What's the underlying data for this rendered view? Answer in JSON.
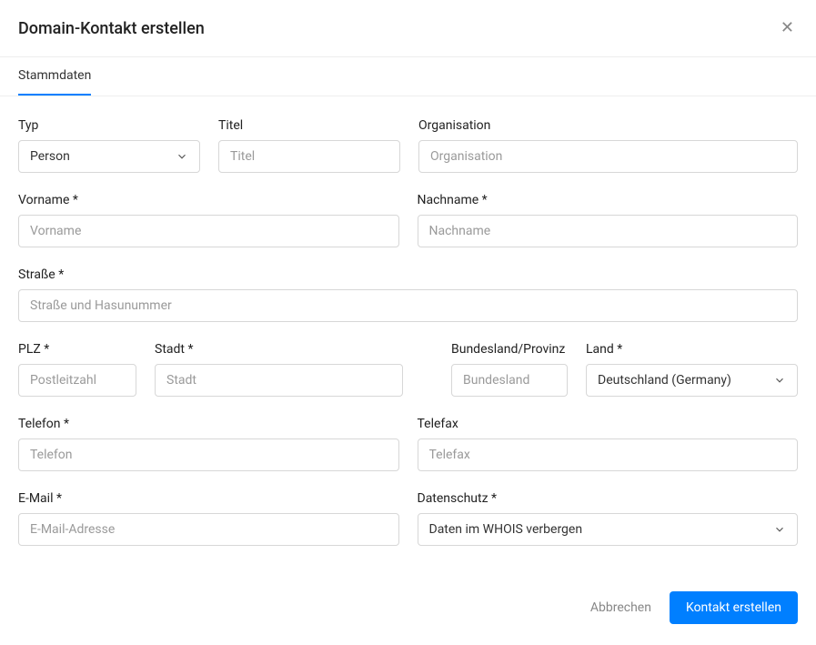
{
  "header": {
    "title": "Domain-Kontakt erstellen"
  },
  "tabs": {
    "stammdaten": "Stammdaten"
  },
  "labels": {
    "type": "Typ",
    "title": "Titel",
    "organisation": "Organisation",
    "firstname": "Vorname *",
    "lastname": "Nachname *",
    "street": "Straße *",
    "zip": "PLZ *",
    "city": "Stadt *",
    "state": "Bundesland/Provinz",
    "country": "Land *",
    "phone": "Telefon *",
    "fax": "Telefax",
    "email": "E-Mail *",
    "privacy": "Datenschutz *"
  },
  "placeholders": {
    "title": "Titel",
    "organisation": "Organisation",
    "firstname": "Vorname",
    "lastname": "Nachname",
    "street": "Straße und Hasunummer",
    "zip": "Postleitzahl",
    "city": "Stadt",
    "state": "Bundesland",
    "phone": "Telefon",
    "fax": "Telefax",
    "email": "E-Mail-Adresse"
  },
  "values": {
    "type": "Person",
    "country": "Deutschland (Germany)",
    "privacy": "Daten im WHOIS verbergen"
  },
  "footer": {
    "cancel": "Abbrechen",
    "submit": "Kontakt erstellen"
  }
}
